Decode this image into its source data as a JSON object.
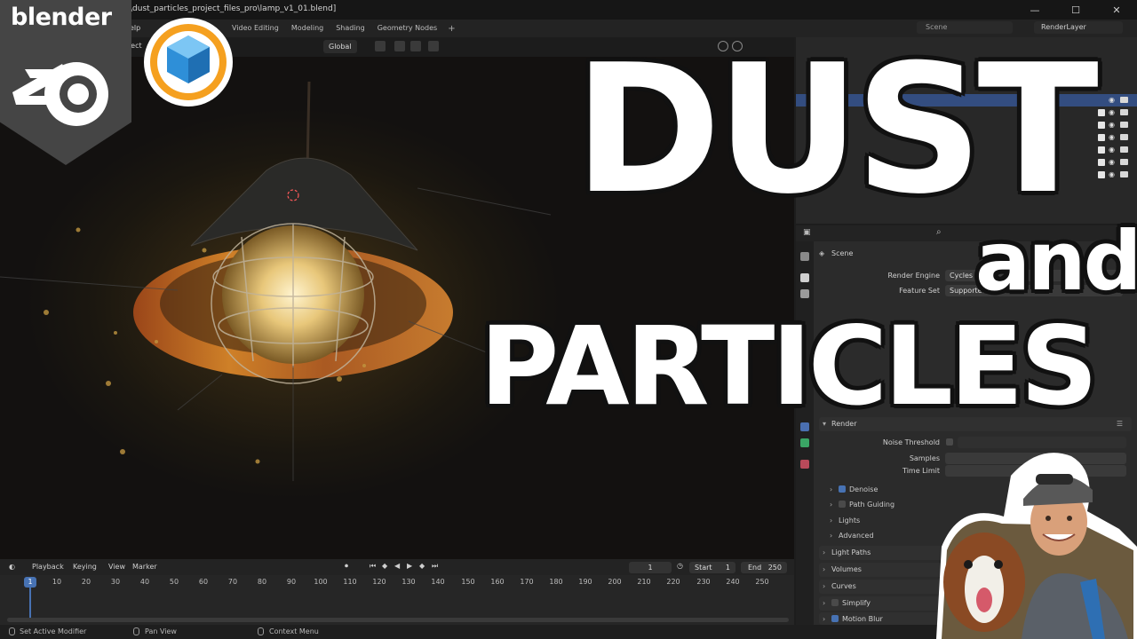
{
  "window": {
    "file_path": "\\dust_particles_project_files_pro\\lamp_v1_01.blend]",
    "controls": [
      "—",
      "☐",
      "✕"
    ]
  },
  "topbar": {
    "menu_partial": "elp",
    "workspaces": [
      "Video Editing",
      "Modeling",
      "Shading",
      "Geometry Nodes"
    ],
    "add_workspace": "+",
    "scene_name": "Scene",
    "view_layer": "RenderLayer"
  },
  "viewport": {
    "select_partial": "elect",
    "orientation": "Global"
  },
  "timeline": {
    "menus": [
      "Playback",
      "Keying",
      "View",
      "Marker"
    ],
    "current_frame": "1",
    "start_label": "Start",
    "start_value": "1",
    "end_label": "End",
    "end_value": "250",
    "ruler": [
      "1",
      "10",
      "20",
      "30",
      "40",
      "50",
      "60",
      "70",
      "80",
      "90",
      "100",
      "110",
      "120",
      "130",
      "140",
      "150",
      "160",
      "170",
      "180",
      "190",
      "200",
      "210",
      "220",
      "230",
      "240",
      "250"
    ]
  },
  "statusbar": {
    "items": [
      "Set Active Modifier",
      "Pan View",
      "Context Menu"
    ]
  },
  "properties": {
    "breadcrumb": "Scene",
    "render_engine_label": "Render Engine",
    "render_engine_value": "Cycles",
    "feature_set_label": "Feature Set",
    "feature_set_value": "Supported",
    "render_section": "Render",
    "noise_threshold_label": "Noise Threshold",
    "samples_label": "Samples",
    "time_limit_label": "Time Limit",
    "subsections": [
      {
        "label": "Denoise",
        "checkbox": true
      },
      {
        "label": "Path Guiding",
        "checkbox": false
      },
      {
        "label": "Lights"
      },
      {
        "label": "Advanced"
      }
    ],
    "sections": [
      {
        "label": "Light Paths"
      },
      {
        "label": "Volumes"
      },
      {
        "label": "Curves"
      },
      {
        "label": "Simplify",
        "checkbox": false
      },
      {
        "label": "Motion Blur",
        "checkbox": true
      }
    ]
  },
  "overlay": {
    "brand": "blender",
    "title_line1": "DUST",
    "title_and": "and",
    "title_line2": "PARTICLES"
  },
  "colors": {
    "accent_blue": "#4772b3",
    "outliner_selected": "#334d80",
    "addon_orange": "#f5a01f",
    "addon_blue": "#2e8fd8"
  }
}
